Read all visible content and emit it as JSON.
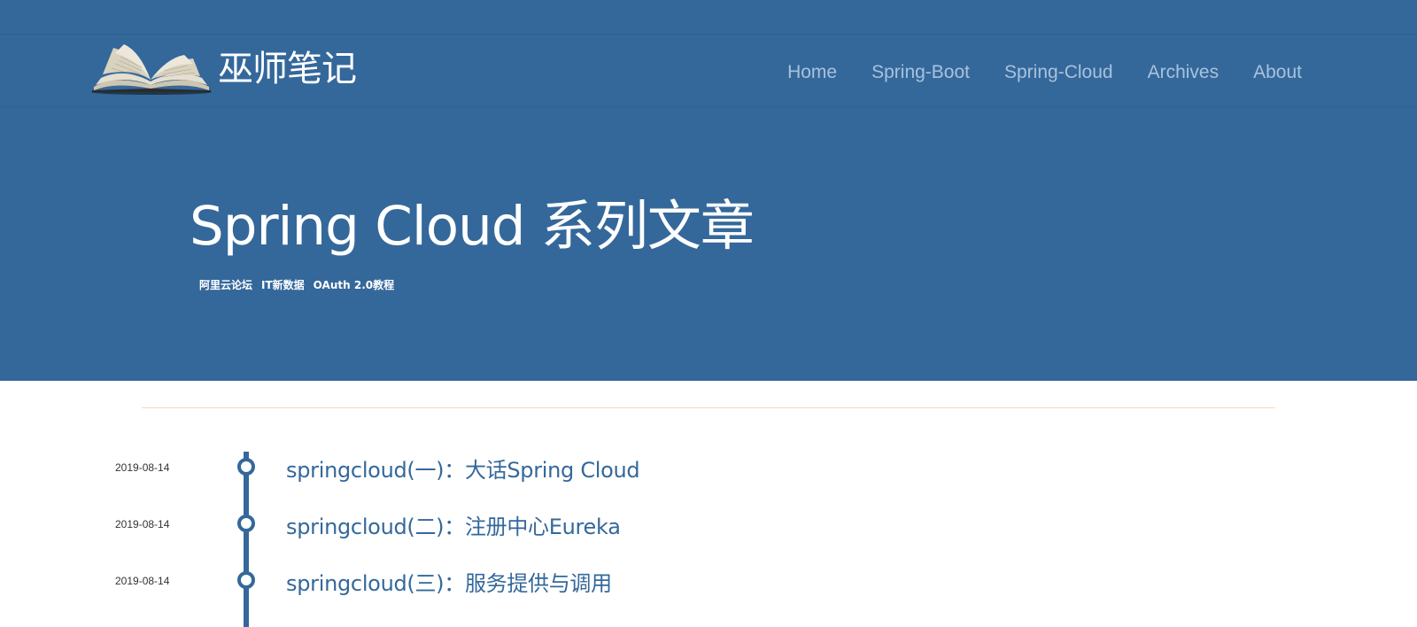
{
  "site": {
    "name": "巫师笔记",
    "logo_icon": "open-book-icon"
  },
  "nav": {
    "items": [
      {
        "label": "Home"
      },
      {
        "label": "Spring-Boot"
      },
      {
        "label": "Spring-Cloud"
      },
      {
        "label": "Archives"
      },
      {
        "label": "About"
      }
    ]
  },
  "hero": {
    "title": "Spring Cloud 系列文章",
    "links": [
      {
        "label": "阿里云论坛"
      },
      {
        "label": "IT新数据"
      },
      {
        "label": "OAuth 2.0教程"
      }
    ]
  },
  "posts": [
    {
      "date": "2019-08-14",
      "title": "springcloud(一)：大话Spring Cloud"
    },
    {
      "date": "2019-08-14",
      "title": "springcloud(二)：注册中心Eureka"
    },
    {
      "date": "2019-08-14",
      "title": "springcloud(三)：服务提供与调用"
    }
  ],
  "colors": {
    "primary": "#34689b",
    "nav_link": "#a8c2dc",
    "divider": "#f3d9c4"
  }
}
